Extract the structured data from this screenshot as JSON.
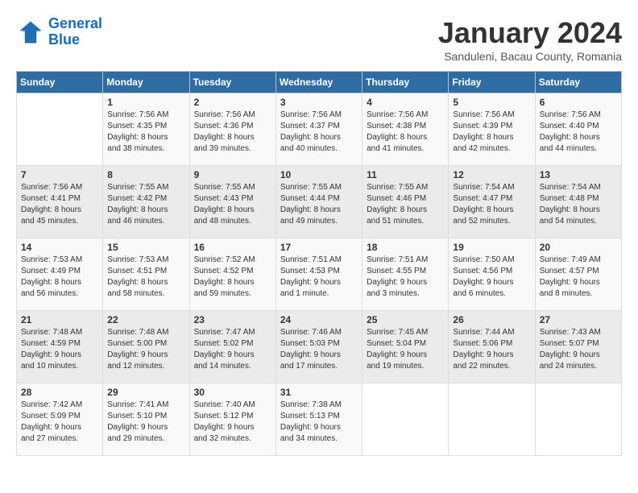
{
  "header": {
    "logo_line1": "General",
    "logo_line2": "Blue",
    "month": "January 2024",
    "location": "Sanduleni, Bacau County, Romania"
  },
  "weekdays": [
    "Sunday",
    "Monday",
    "Tuesday",
    "Wednesday",
    "Thursday",
    "Friday",
    "Saturday"
  ],
  "weeks": [
    [
      {
        "day": "",
        "info": ""
      },
      {
        "day": "1",
        "info": "Sunrise: 7:56 AM\nSunset: 4:35 PM\nDaylight: 8 hours\nand 38 minutes."
      },
      {
        "day": "2",
        "info": "Sunrise: 7:56 AM\nSunset: 4:36 PM\nDaylight: 8 hours\nand 39 minutes."
      },
      {
        "day": "3",
        "info": "Sunrise: 7:56 AM\nSunset: 4:37 PM\nDaylight: 8 hours\nand 40 minutes."
      },
      {
        "day": "4",
        "info": "Sunrise: 7:56 AM\nSunset: 4:38 PM\nDaylight: 8 hours\nand 41 minutes."
      },
      {
        "day": "5",
        "info": "Sunrise: 7:56 AM\nSunset: 4:39 PM\nDaylight: 8 hours\nand 42 minutes."
      },
      {
        "day": "6",
        "info": "Sunrise: 7:56 AM\nSunset: 4:40 PM\nDaylight: 8 hours\nand 44 minutes."
      }
    ],
    [
      {
        "day": "7",
        "info": "Sunrise: 7:56 AM\nSunset: 4:41 PM\nDaylight: 8 hours\nand 45 minutes."
      },
      {
        "day": "8",
        "info": "Sunrise: 7:55 AM\nSunset: 4:42 PM\nDaylight: 8 hours\nand 46 minutes."
      },
      {
        "day": "9",
        "info": "Sunrise: 7:55 AM\nSunset: 4:43 PM\nDaylight: 8 hours\nand 48 minutes."
      },
      {
        "day": "10",
        "info": "Sunrise: 7:55 AM\nSunset: 4:44 PM\nDaylight: 8 hours\nand 49 minutes."
      },
      {
        "day": "11",
        "info": "Sunrise: 7:55 AM\nSunset: 4:46 PM\nDaylight: 8 hours\nand 51 minutes."
      },
      {
        "day": "12",
        "info": "Sunrise: 7:54 AM\nSunset: 4:47 PM\nDaylight: 8 hours\nand 52 minutes."
      },
      {
        "day": "13",
        "info": "Sunrise: 7:54 AM\nSunset: 4:48 PM\nDaylight: 8 hours\nand 54 minutes."
      }
    ],
    [
      {
        "day": "14",
        "info": "Sunrise: 7:53 AM\nSunset: 4:49 PM\nDaylight: 8 hours\nand 56 minutes."
      },
      {
        "day": "15",
        "info": "Sunrise: 7:53 AM\nSunset: 4:51 PM\nDaylight: 8 hours\nand 58 minutes."
      },
      {
        "day": "16",
        "info": "Sunrise: 7:52 AM\nSunset: 4:52 PM\nDaylight: 8 hours\nand 59 minutes."
      },
      {
        "day": "17",
        "info": "Sunrise: 7:51 AM\nSunset: 4:53 PM\nDaylight: 9 hours\nand 1 minute."
      },
      {
        "day": "18",
        "info": "Sunrise: 7:51 AM\nSunset: 4:55 PM\nDaylight: 9 hours\nand 3 minutes."
      },
      {
        "day": "19",
        "info": "Sunrise: 7:50 AM\nSunset: 4:56 PM\nDaylight: 9 hours\nand 6 minutes."
      },
      {
        "day": "20",
        "info": "Sunrise: 7:49 AM\nSunset: 4:57 PM\nDaylight: 9 hours\nand 8 minutes."
      }
    ],
    [
      {
        "day": "21",
        "info": "Sunrise: 7:48 AM\nSunset: 4:59 PM\nDaylight: 9 hours\nand 10 minutes."
      },
      {
        "day": "22",
        "info": "Sunrise: 7:48 AM\nSunset: 5:00 PM\nDaylight: 9 hours\nand 12 minutes."
      },
      {
        "day": "23",
        "info": "Sunrise: 7:47 AM\nSunset: 5:02 PM\nDaylight: 9 hours\nand 14 minutes."
      },
      {
        "day": "24",
        "info": "Sunrise: 7:46 AM\nSunset: 5:03 PM\nDaylight: 9 hours\nand 17 minutes."
      },
      {
        "day": "25",
        "info": "Sunrise: 7:45 AM\nSunset: 5:04 PM\nDaylight: 9 hours\nand 19 minutes."
      },
      {
        "day": "26",
        "info": "Sunrise: 7:44 AM\nSunset: 5:06 PM\nDaylight: 9 hours\nand 22 minutes."
      },
      {
        "day": "27",
        "info": "Sunrise: 7:43 AM\nSunset: 5:07 PM\nDaylight: 9 hours\nand 24 minutes."
      }
    ],
    [
      {
        "day": "28",
        "info": "Sunrise: 7:42 AM\nSunset: 5:09 PM\nDaylight: 9 hours\nand 27 minutes."
      },
      {
        "day": "29",
        "info": "Sunrise: 7:41 AM\nSunset: 5:10 PM\nDaylight: 9 hours\nand 29 minutes."
      },
      {
        "day": "30",
        "info": "Sunrise: 7:40 AM\nSunset: 5:12 PM\nDaylight: 9 hours\nand 32 minutes."
      },
      {
        "day": "31",
        "info": "Sunrise: 7:38 AM\nSunset: 5:13 PM\nDaylight: 9 hours\nand 34 minutes."
      },
      {
        "day": "",
        "info": ""
      },
      {
        "day": "",
        "info": ""
      },
      {
        "day": "",
        "info": ""
      }
    ]
  ]
}
